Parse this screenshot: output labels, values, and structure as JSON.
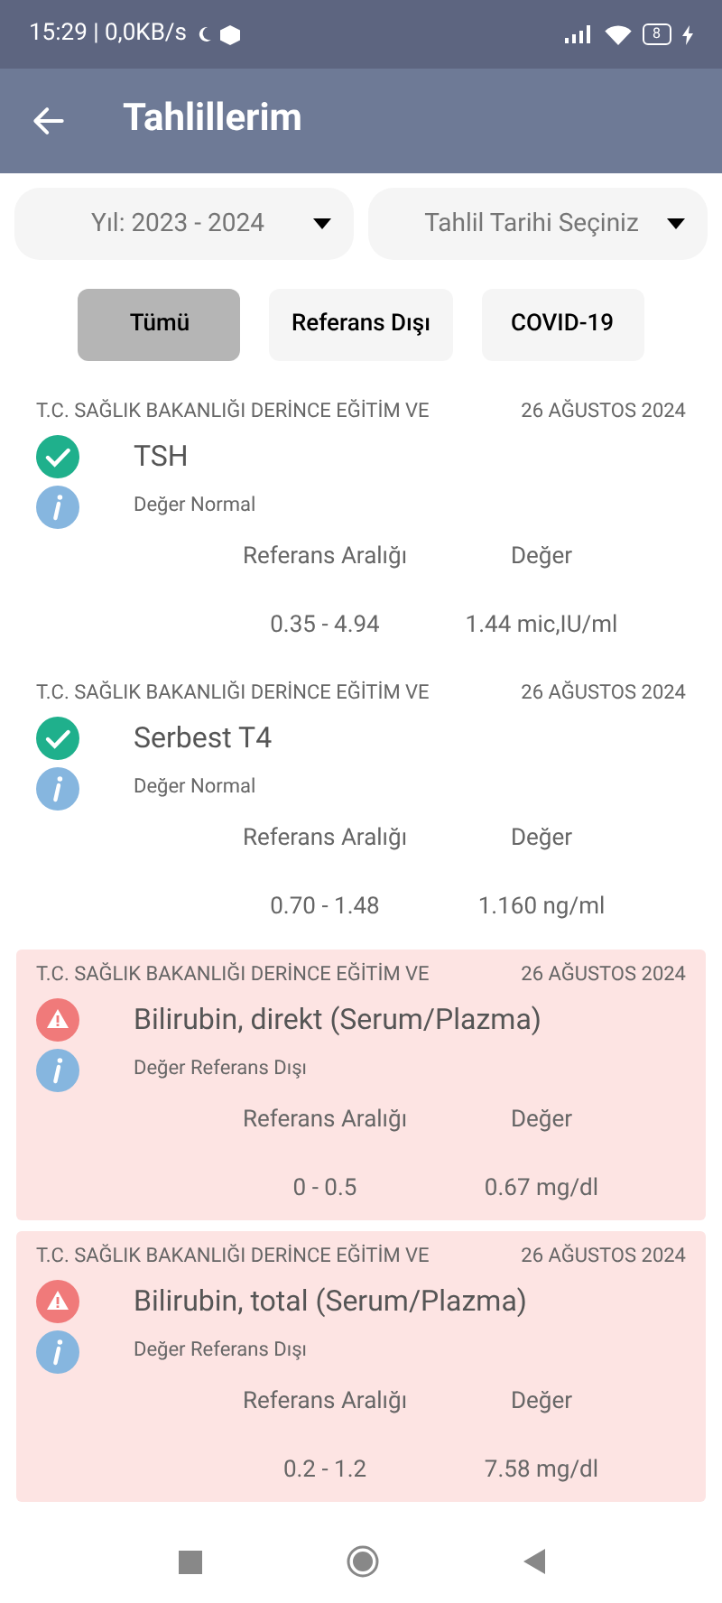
{
  "status_bar": {
    "time_speed": "15:29 | 0,0KB/s",
    "battery": "8"
  },
  "header": {
    "title": "Tahlillerim"
  },
  "filters": [
    {
      "value": "Yıl: 2023 - 2024"
    },
    {
      "value": "Tahlil Tarihi Seçiniz"
    }
  ],
  "tabs": [
    {
      "label": "Tümü",
      "selected": true
    },
    {
      "label": "Referans Dışı",
      "selected": false
    },
    {
      "label": "COVID-19",
      "selected": false
    }
  ],
  "results": [
    {
      "hospital": "T.C. SAĞLIK BAKANLIĞI DERİNCE EĞİTİM VE",
      "date": "26 AĞUSTOS 2024",
      "test": "TSH",
      "kind": "normal",
      "status": "Değer Normal",
      "range_label": "Referans Aralığı",
      "value_label": "Değer",
      "range": "0.35 - 4.94",
      "value": "1.44 mic,IU/ml"
    },
    {
      "hospital": "T.C. SAĞLIK BAKANLIĞI DERİNCE EĞİTİM VE",
      "date": "26 AĞUSTOS 2024",
      "test": "Serbest T4",
      "kind": "normal",
      "status": "Değer Normal",
      "range_label": "Referans Aralığı",
      "value_label": "Değer",
      "range": "0.70 - 1.48",
      "value": "1.160 ng/ml"
    },
    {
      "hospital": "T.C. SAĞLIK BAKANLIĞI DERİNCE EĞİTİM VE",
      "date": "26 AĞUSTOS 2024",
      "test": "Bilirubin, direkt (Serum/Plazma)",
      "kind": "out_of_range",
      "status": "Değer Referans Dışı",
      "range_label": "Referans Aralığı",
      "value_label": "Değer",
      "range": "0 - 0.5",
      "value": "0.67 mg/dl"
    },
    {
      "hospital": "T.C. SAĞLIK BAKANLIĞI DERİNCE EĞİTİM VE",
      "date": "26 AĞUSTOS 2024",
      "test": "Bilirubin, total (Serum/Plazma)",
      "kind": "out_of_range",
      "status": "Değer Referans Dışı",
      "range_label": "Referans Aralığı",
      "value_label": "Değer",
      "range": "0.2 - 1.2",
      "value": "7.58 mg/dl"
    }
  ]
}
